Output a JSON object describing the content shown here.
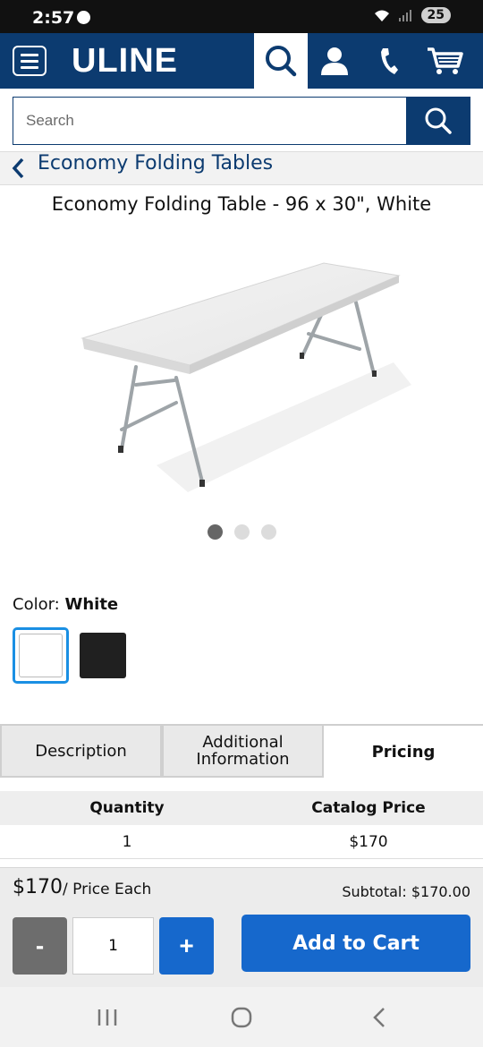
{
  "status_bar": {
    "time": "2:57",
    "battery": "25"
  },
  "header": {
    "logo": "ULINE"
  },
  "search": {
    "placeholder": "Search"
  },
  "breadcrumb": {
    "label": "Economy Folding Tables"
  },
  "product": {
    "title": "Economy Folding Table - 96 x 30\", White",
    "image_count": 3,
    "active_image": 1
  },
  "color": {
    "label": "Color:",
    "selected": "White",
    "options": [
      "White",
      "Black"
    ]
  },
  "tabs": [
    {
      "label": "Description",
      "active": false
    },
    {
      "label": "Additional Information",
      "active": false
    },
    {
      "label": "Pricing",
      "active": true
    }
  ],
  "pricing_table": {
    "headers": [
      "Quantity",
      "Catalog Price"
    ],
    "rows": [
      [
        "1",
        "$170"
      ]
    ]
  },
  "cart": {
    "price": "$170",
    "price_suffix": "/ Price Each",
    "subtotal": "Subtotal: $170.00",
    "minus_label": "-",
    "quantity": "1",
    "plus_label": "+",
    "add_label": "Add to Cart"
  },
  "colors": {
    "brand": "#0c3b70",
    "button": "#1668cc",
    "selected_swatch": "#1a8fe3"
  }
}
